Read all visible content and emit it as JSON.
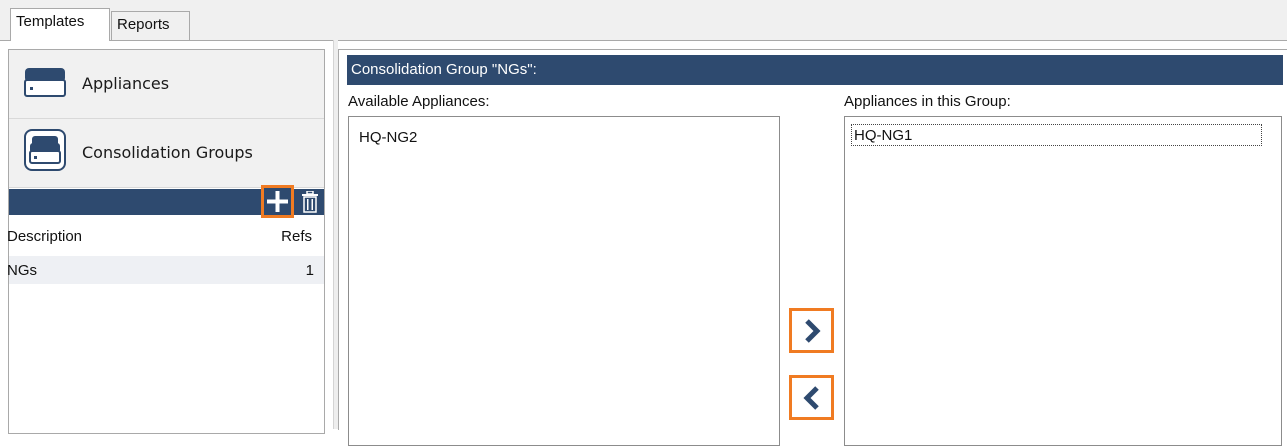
{
  "tabs": [
    {
      "label": "Templates",
      "active": true
    },
    {
      "label": "Reports",
      "active": false
    }
  ],
  "nav": {
    "appliances": {
      "label": "Appliances",
      "icon": "appliance-icon"
    },
    "consolidation_groups": {
      "label": "Consolidation Groups",
      "icon": "consolidation-groups-icon"
    }
  },
  "toolbar": {
    "add_icon": "plus-icon",
    "delete_icon": "trash-icon"
  },
  "groups_table": {
    "columns": [
      "Description",
      "Refs"
    ],
    "rows": [
      {
        "description": "NGs",
        "refs": "1"
      }
    ]
  },
  "group_panel": {
    "title": "Consolidation Group \"NGs\":",
    "available_label": "Available Appliances:",
    "in_group_label": "Appliances in this Group:",
    "available_items": [
      "HQ-NG2"
    ],
    "in_group_items": [
      "HQ-NG1"
    ],
    "move_right_icon": "chevron-right-icon",
    "move_left_icon": "chevron-left-icon"
  },
  "colors": {
    "header_bar": "#2e4a6f",
    "highlight": "#f07b22",
    "selected_row": "#eef0f4",
    "panel_bg": "#f1f1f1"
  }
}
